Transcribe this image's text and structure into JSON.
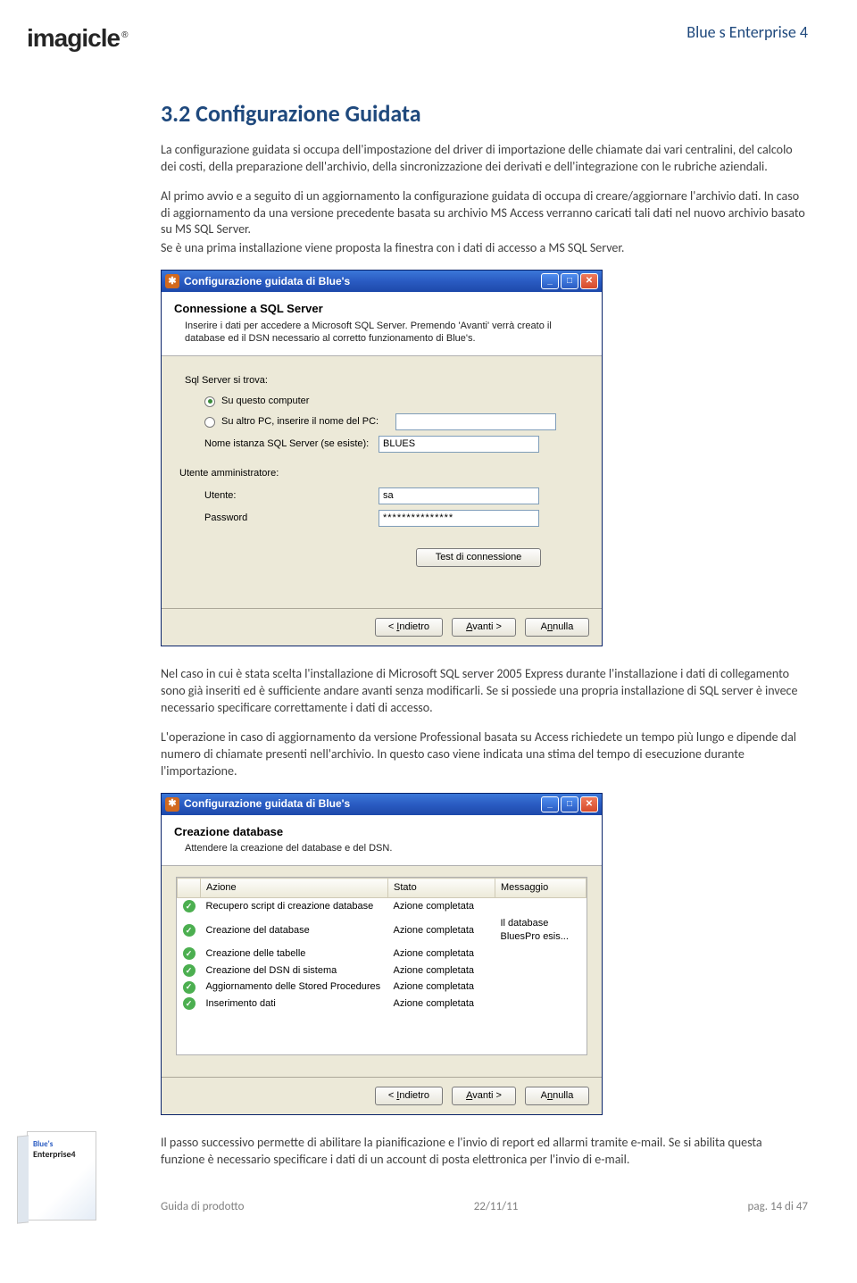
{
  "header": {
    "logo": "imagicle",
    "product_title": "Blue s Enterprise 4"
  },
  "section": {
    "heading": "3.2  Configurazione Guidata",
    "p1": "La configurazione guidata si occupa dell'impostazione del driver di importazione delle chiamate dai vari centralini, del calcolo dei costi, della preparazione dell'archivio, della sincronizzazione dei derivati e dell'integrazione con le rubriche aziendali.",
    "p2": "Al primo avvio e a seguito di un aggiornamento la configurazione guidata di occupa di creare/aggiornare l'archivio dati. In caso di aggiornamento da una versione precedente basata su archivio MS Access verranno caricati tali dati nel nuovo archivio basato su MS SQL Server.",
    "p3": "Se è una prima installazione viene proposta la finestra con i dati di accesso a MS SQL Server.",
    "p4": "Nel caso in cui è stata scelta l'installazione di Microsoft SQL server 2005 Express durante l'installazione i dati di collegamento sono già inseriti ed è sufficiente andare avanti senza modificarli. Se si possiede una propria installazione di SQL server è invece necessario specificare correttamente i dati di accesso.",
    "p5": "L'operazione in caso di aggiornamento da versione Professional basata su Access richiedete un tempo più lungo e dipende dal numero di chiamate presenti nell'archivio. In questo caso viene indicata una stima del tempo di esecuzione durante l'importazione.",
    "p6": "Il passo successivo permette di abilitare la pianificazione e l'invio di report ed allarmi tramite e-mail. Se si abilita questa funzione è necessario specificare i dati di un account di posta elettronica per l'invio di e-mail."
  },
  "win1": {
    "title": "Configurazione guidata di Blue's",
    "banner_title": "Connessione a SQL Server",
    "banner_desc": "Inserire i dati per accedere a Microsoft SQL Server. Premendo 'Avanti' verrà creato il database ed il DSN necessario al corretto funzionamento di Blue's.",
    "sql_server_label": "Sql Server si trova:",
    "radio1": "Su questo computer",
    "radio2": "Su altro PC, inserire il nome del PC:",
    "instance_label": "Nome istanza SQL Server (se esiste):",
    "instance_value": "BLUES",
    "admin_label": "Utente amministratore:",
    "user_label": "Utente:",
    "user_value": "sa",
    "pass_label": "Password",
    "pass_value": "***************",
    "test_btn": "Test di connessione",
    "back_btn": "< Indietro",
    "next_btn": "Avanti >",
    "cancel_btn": "Annulla"
  },
  "win2": {
    "title": "Configurazione guidata di Blue's",
    "banner_title": "Creazione database",
    "banner_desc": "Attendere la creazione del database e del DSN.",
    "col_action": "Azione",
    "col_state": "Stato",
    "col_msg": "Messaggio",
    "rows": [
      {
        "a": "Recupero script di creazione database",
        "s": "Azione completata",
        "m": ""
      },
      {
        "a": "Creazione del database",
        "s": "Azione completata",
        "m": "Il database BluesPro esis..."
      },
      {
        "a": "Creazione delle tabelle",
        "s": "Azione completata",
        "m": ""
      },
      {
        "a": "Creazione del DSN di sistema",
        "s": "Azione completata",
        "m": ""
      },
      {
        "a": "Aggiornamento delle Stored Procedures",
        "s": "Azione completata",
        "m": ""
      },
      {
        "a": "Inserimento dati",
        "s": "Azione completata",
        "m": ""
      }
    ],
    "back_btn": "< Indietro",
    "next_btn": "Avanti >",
    "cancel_btn": "Annulla"
  },
  "footer": {
    "left": "Guida di prodotto",
    "center": "22/11/11",
    "right": "pag. 14 di 47"
  },
  "product_box": {
    "line1": "Blue's",
    "line2": "Enterprise4"
  }
}
